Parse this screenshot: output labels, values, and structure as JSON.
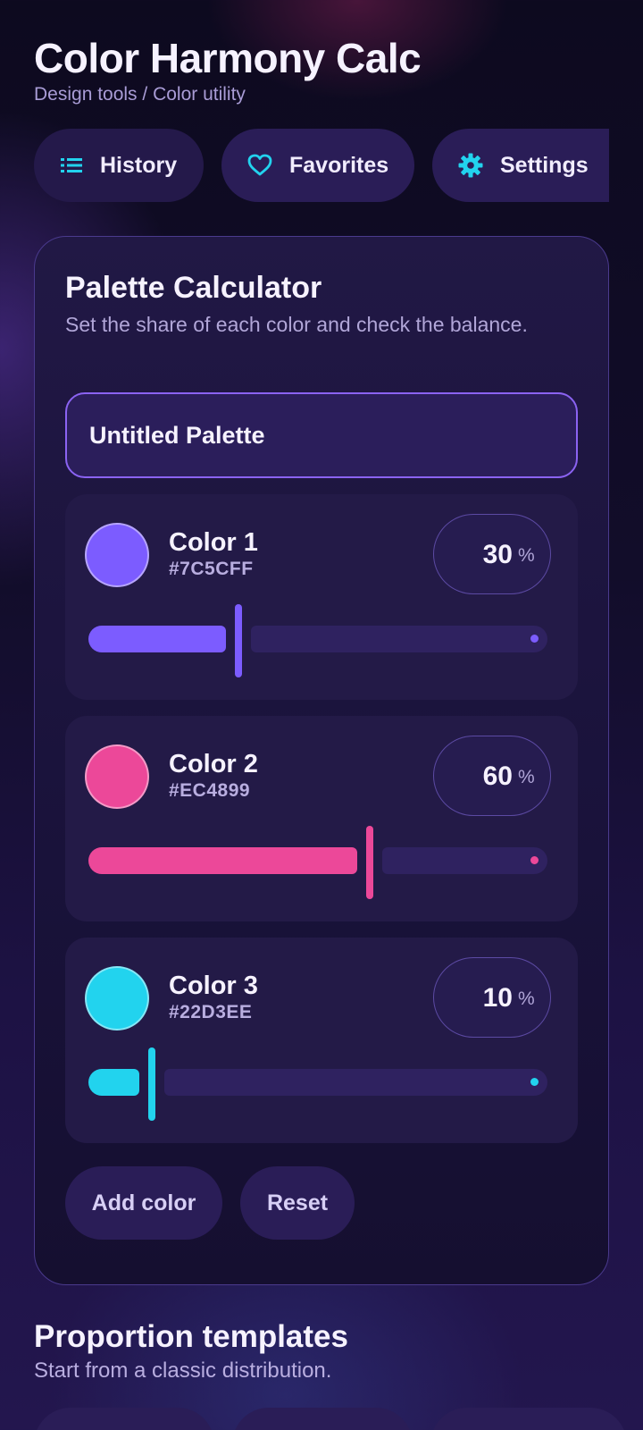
{
  "header": {
    "title": "Color Harmony Calc",
    "breadcrumb": "Design tools / Color utility"
  },
  "nav_chips": {
    "history": {
      "label": "History",
      "icon": "list-icon"
    },
    "favorites": {
      "label": "Favorites",
      "icon": "heart-icon"
    },
    "settings": {
      "label": "Settings",
      "icon": "gear-icon"
    }
  },
  "calculator": {
    "title": "Palette Calculator",
    "description": "Set the share of each color and check the balance.",
    "palette_name": "Untitled Palette",
    "colors": [
      {
        "name": "Color 1",
        "hex": "#7C5CFF",
        "percent": "30",
        "unit": "%",
        "share": 0.3
      },
      {
        "name": "Color 2",
        "hex": "#EC4899",
        "percent": "60",
        "unit": "%",
        "share": 0.6
      },
      {
        "name": "Color 3",
        "hex": "#22D3EE",
        "percent": "10",
        "unit": "%",
        "share": 0.1
      }
    ],
    "add_label": "Add color",
    "reset_label": "Reset"
  },
  "templates": {
    "title": "Proportion templates",
    "description": "Start from a classic distribution."
  },
  "colors": {
    "accent": "#8B63F2",
    "icon_accent": "#22D3EE"
  }
}
